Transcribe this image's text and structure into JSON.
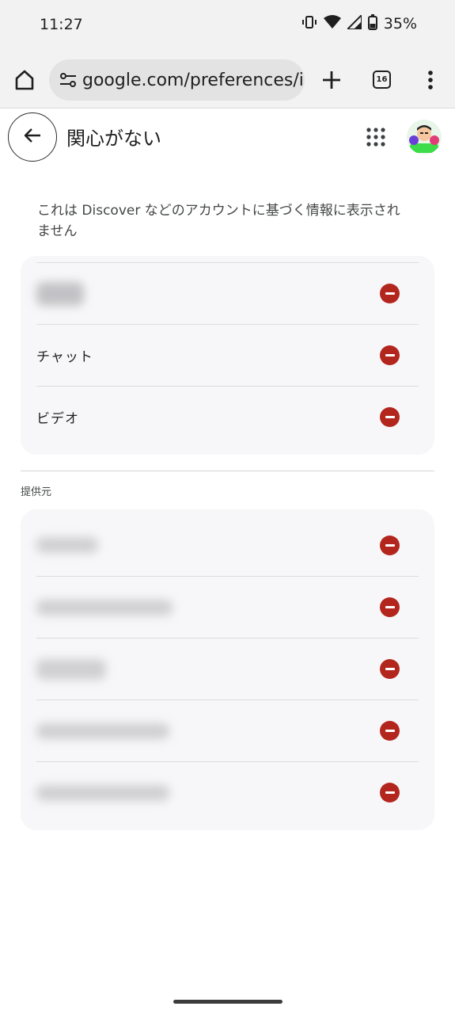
{
  "status_bar": {
    "time": "11:27",
    "battery": "35%",
    "icons": [
      "vibrate-icon",
      "wifi-icon",
      "signal-icon",
      "battery-icon"
    ]
  },
  "browser": {
    "url": "google.com/preferences/i",
    "tab_count": "16",
    "icons": [
      "home-icon",
      "tune-icon",
      "plus-icon",
      "tab-switcher-icon",
      "more-vert-icon"
    ]
  },
  "header": {
    "title": "関心がない",
    "icons": [
      "arrow-back-icon",
      "apps-grid-icon",
      "avatar"
    ]
  },
  "description": "これは Discover などのアカウントに基づく情報に表示されません",
  "interests": {
    "items": [
      {
        "label": "",
        "blurred": true
      },
      {
        "label": "チャット",
        "blurred": false
      },
      {
        "label": "ビデオ",
        "blurred": false
      }
    ]
  },
  "providers": {
    "label": "提供元",
    "items": [
      {
        "label": "",
        "blurred": true
      },
      {
        "label": "",
        "blurred": true
      },
      {
        "label": "",
        "blurred": true
      },
      {
        "label": "",
        "blurred": true
      },
      {
        "label": "",
        "blurred": true
      }
    ]
  },
  "colors": {
    "remove": "#b3261e",
    "card_bg": "#f7f7f9",
    "chrome_bg": "#f2f2f2"
  }
}
